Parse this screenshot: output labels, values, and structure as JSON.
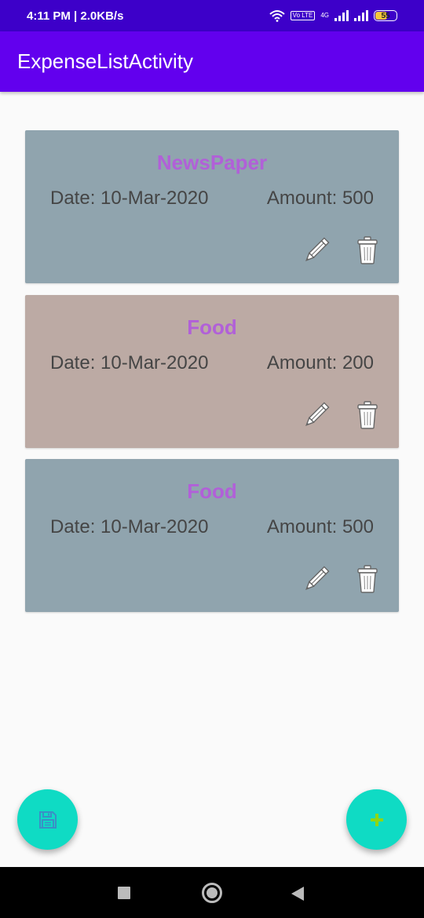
{
  "status_bar": {
    "time_speed": "4:11 PM | 2.0KB/s",
    "network_type": "4G",
    "volte": "Vo LTE",
    "battery": "55"
  },
  "toolbar": {
    "title": "ExpenseListActivity"
  },
  "expenses": [
    {
      "name": "NewsPaper",
      "date": "Date: 10-Mar-2020",
      "amount": "Amount: 500",
      "color": "#90a4ae"
    },
    {
      "name": "Food",
      "date": "Date: 10-Mar-2020",
      "amount": "Amount: 200",
      "color": "#bcaaa4"
    },
    {
      "name": "Food",
      "date": "Date: 10-Mar-2020",
      "amount": "Amount: 500",
      "color": "#90a4ae"
    }
  ],
  "icons": {
    "edit": "pencil-icon",
    "delete": "trash-icon",
    "save_fab": "floppy-disk-icon",
    "add_fab": "plus-icon"
  },
  "colors": {
    "status_bar": "#3d00c9",
    "toolbar": "#6200ee",
    "fab": "#0fdbc4",
    "expense_name": "#b160d8"
  }
}
